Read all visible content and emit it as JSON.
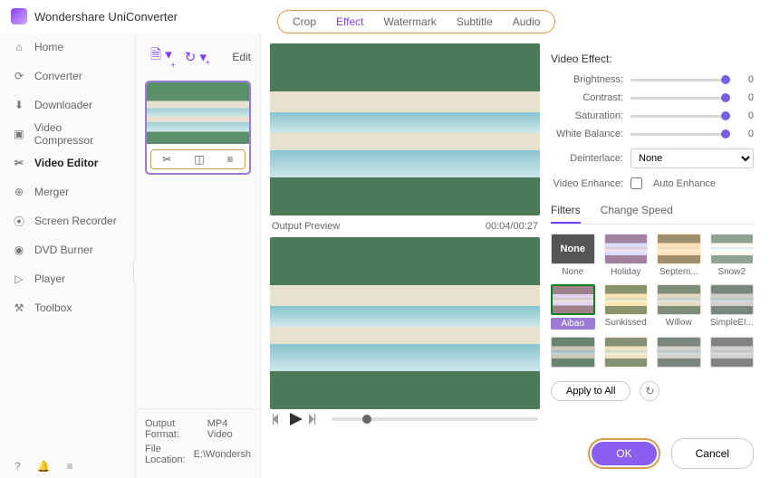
{
  "app": {
    "title": "Wondershare UniConverter"
  },
  "sidebar": {
    "items": [
      {
        "label": "Home"
      },
      {
        "label": "Converter"
      },
      {
        "label": "Downloader"
      },
      {
        "label": "Video Compressor"
      },
      {
        "label": "Video Editor"
      },
      {
        "label": "Merger"
      },
      {
        "label": "Screen Recorder"
      },
      {
        "label": "DVD Burner"
      },
      {
        "label": "Player"
      },
      {
        "label": "Toolbox"
      }
    ],
    "active_index": 4
  },
  "mid": {
    "edit_label": "Edit",
    "output_format_label": "Output Format:",
    "output_format_value": "MP4 Video",
    "file_location_label": "File Location:",
    "file_location_value": "E:\\Wondersh"
  },
  "tabs": {
    "items": [
      "Crop",
      "Effect",
      "Watermark",
      "Subtitle",
      "Audio"
    ],
    "active_index": 1
  },
  "preview": {
    "label": "Output Preview",
    "time": "00:04/00:27"
  },
  "video_effect": {
    "title": "Video Effect:",
    "brightness_label": "Brightness:",
    "brightness_value": "0",
    "contrast_label": "Contrast:",
    "contrast_value": "0",
    "saturation_label": "Saturation:",
    "saturation_value": "0",
    "whitebalance_label": "White Balance:",
    "whitebalance_value": "0",
    "deinterlace_label": "Deinterlace:",
    "deinterlace_value": "None",
    "enhance_label": "Video Enhance:",
    "enhance_checkbox": "Auto Enhance"
  },
  "subtabs": {
    "items": [
      "Filters",
      "Change Speed"
    ],
    "active_index": 0
  },
  "filters": {
    "items": [
      {
        "name": "None"
      },
      {
        "name": "Holiday"
      },
      {
        "name": "Septem..."
      },
      {
        "name": "Snow2"
      },
      {
        "name": "Aibao"
      },
      {
        "name": "Sunkissed"
      },
      {
        "name": "Willow"
      },
      {
        "name": "SimpleEl..."
      },
      {
        "name": ""
      },
      {
        "name": ""
      },
      {
        "name": ""
      },
      {
        "name": ""
      }
    ],
    "selected_index": 4,
    "apply_label": "Apply to All"
  },
  "footer": {
    "ok": "OK",
    "cancel": "Cancel"
  }
}
